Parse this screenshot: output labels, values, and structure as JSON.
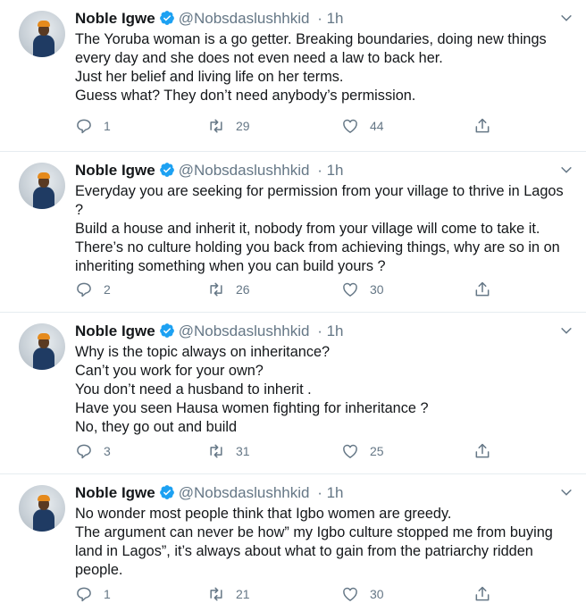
{
  "tweets": [
    {
      "name": "Noble Igwe",
      "handle": "@Nobsdaslushhkid",
      "time": "· 1h",
      "lines": [
        "The Yoruba woman is a go getter. Breaking boundaries, doing new things",
        "every day and she does not even need a law to back her.",
        "Just her belief and living life on her terms.",
        "Guess what? They don’t need anybody’s permission."
      ],
      "replies": "1",
      "retweets": "29",
      "likes": "44"
    },
    {
      "name": "Noble Igwe",
      "handle": "@Nobsdaslushhkid",
      "time": "· 1h",
      "lines": [
        "Everyday you are seeking for permission from your village to thrive in Lagos",
        "?",
        "Build a house and inherit it, nobody from your village will come to take it.",
        "There’s no culture holding you back from achieving things, why are so in on",
        "inheriting something when you can build yours ?"
      ],
      "replies": "2",
      "retweets": "26",
      "likes": "30"
    },
    {
      "name": "Noble Igwe",
      "handle": "@Nobsdaslushhkid",
      "time": "· 1h",
      "lines": [
        "Why is the topic always on inheritance?",
        "Can’t you work for your own?",
        "You don’t need a husband to inherit .",
        "Have you seen Hausa women fighting for inheritance ?",
        "No, they go out and build"
      ],
      "replies": "3",
      "retweets": "31",
      "likes": "25"
    },
    {
      "name": "Noble Igwe",
      "handle": "@Nobsdaslushhkid",
      "time": "· 1h",
      "lines": [
        "No wonder most people think that Igbo women are greedy.",
        "The argument can never be how” my Igbo culture stopped me from buying",
        "land in Lagos”, it’s always about what to gain from the patriarchy ridden",
        "people."
      ],
      "replies": "1",
      "retweets": "21",
      "likes": "30"
    }
  ],
  "icons": {
    "verified": "verified-badge-icon",
    "chevron": "chevron-down-icon",
    "reply": "reply-icon",
    "retweet": "retweet-icon",
    "like": "heart-icon",
    "share": "share-icon"
  },
  "colors": {
    "verified": "#1da1f2",
    "muted": "#657786",
    "text": "#14171a"
  }
}
